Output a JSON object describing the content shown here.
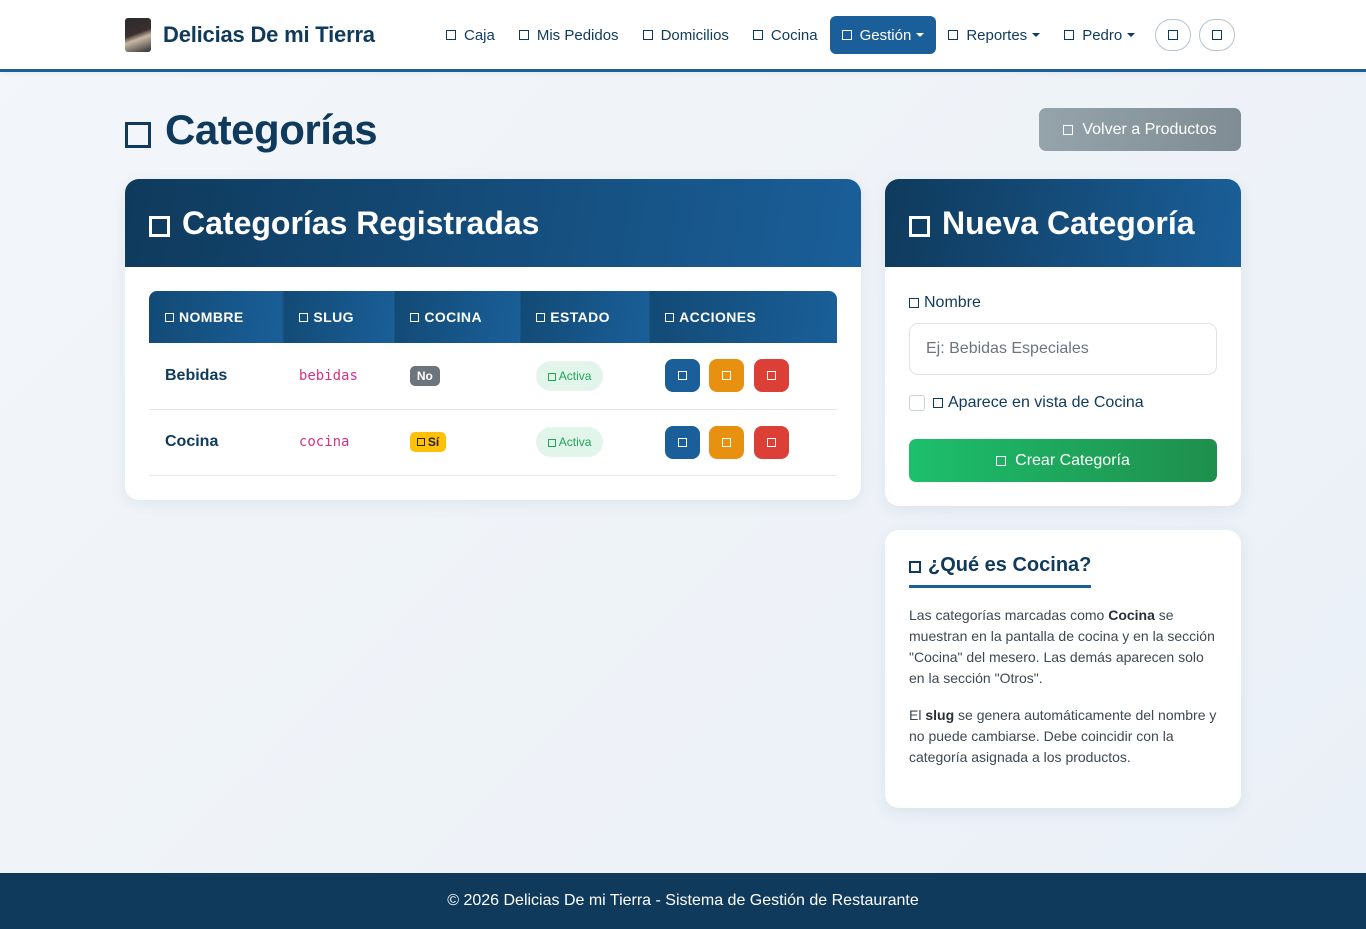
{
  "brand": {
    "name": "Delicias De mi Tierra"
  },
  "nav": {
    "items": [
      {
        "label": "Caja"
      },
      {
        "label": "Mis Pedidos"
      },
      {
        "label": "Domicilios"
      },
      {
        "label": "Cocina"
      },
      {
        "label": "Gestión"
      },
      {
        "label": "Reportes"
      },
      {
        "label": "Pedro"
      }
    ],
    "active": "Gestión"
  },
  "page": {
    "title": "Categorías",
    "back_button": "Volver a Productos"
  },
  "list": {
    "title": "Categorías Registradas",
    "columns": [
      "NOMBRE",
      "SLUG",
      "COCINA",
      "ESTADO",
      "ACCIONES"
    ],
    "rows": [
      {
        "nombre": "Bebidas",
        "slug": "bebidas",
        "cocina": "No",
        "estado": "Activa"
      },
      {
        "nombre": "Cocina",
        "slug": "cocina",
        "cocina": "Sí",
        "estado": "Activa"
      }
    ]
  },
  "form": {
    "title": "Nueva Categoría",
    "name_label": "Nombre",
    "name_placeholder": "Ej: Bebidas Especiales",
    "name_value": "",
    "checkbox_label": "Aparece en vista de Cocina",
    "checkbox_checked": false,
    "submit_label": "Crear Categoría"
  },
  "info": {
    "title": "¿Qué es Cocina?",
    "p1_a": "Las categorías marcadas como ",
    "p1_b": "Cocina",
    "p1_c": " se muestran en la pantalla de cocina y en la sección \"Cocina\" del mesero. Las demás aparecen solo en la sección \"Otros\".",
    "p2_a": "El ",
    "p2_b": "slug",
    "p2_c": " se genera automáticamente del nombre y no puede cambiarse. Debe coincidir con la categoría asignada a los productos."
  },
  "footer": {
    "text": "© 2026 Delicias De mi Tierra - Sistema de Gestión de Restaurante"
  },
  "colors": {
    "primary": "#1a5f99",
    "dark": "#0f3a5c",
    "success": "#1dbf6c",
    "warning": "#e8900f",
    "danger": "#dc3f35",
    "secondary": "#7f8c93"
  }
}
